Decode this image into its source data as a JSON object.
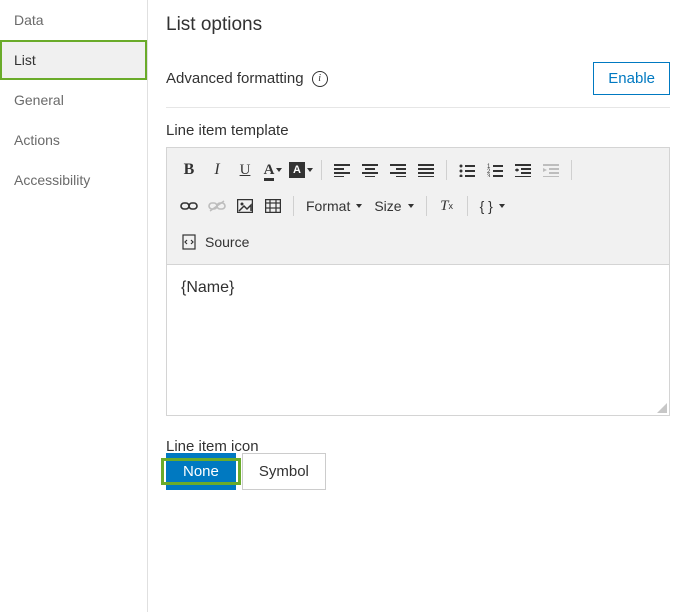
{
  "sidebar": {
    "items": [
      {
        "label": "Data"
      },
      {
        "label": "List"
      },
      {
        "label": "General"
      },
      {
        "label": "Actions"
      },
      {
        "label": "Accessibility"
      }
    ]
  },
  "main": {
    "title": "List options",
    "adv_label": "Advanced formatting",
    "enable_label": "Enable",
    "template_label": "Line item template",
    "body_text": "{Name}",
    "icon_label": "Line item icon",
    "seg_none": "None",
    "seg_symbol": "Symbol",
    "format_label": "Format",
    "size_label": "Size",
    "source_label": "Source",
    "braces_label": "{ }"
  }
}
